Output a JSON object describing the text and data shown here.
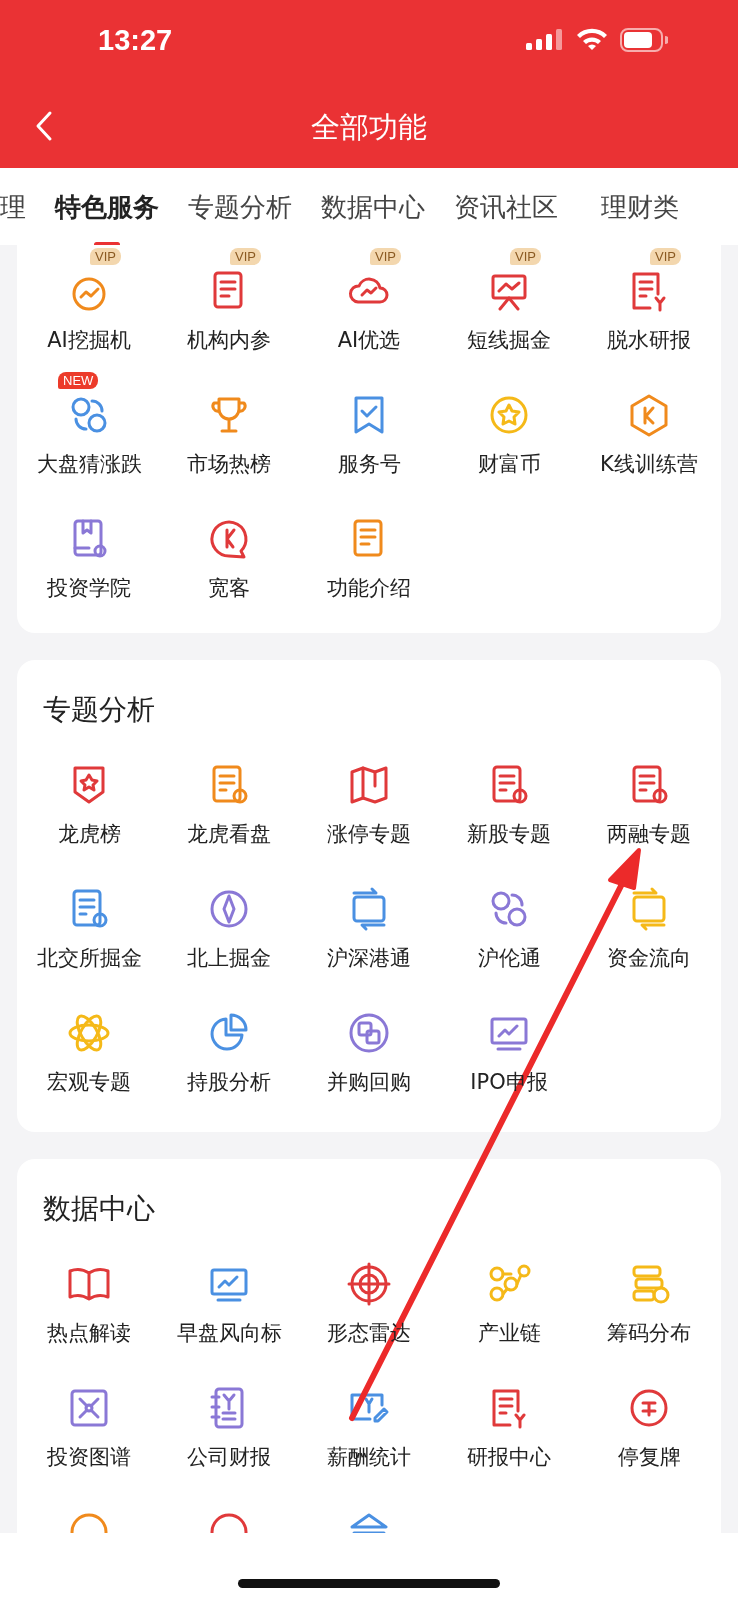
{
  "status_bar": {
    "time": "13:27"
  },
  "header": {
    "title": "全部功能"
  },
  "tabs": [
    {
      "label": "理",
      "selected": false
    },
    {
      "label": "特色服务",
      "selected": true
    },
    {
      "label": "专题分析",
      "selected": false
    },
    {
      "label": "数据中心",
      "selected": false
    },
    {
      "label": "资讯社区",
      "selected": false
    },
    {
      "label": "理财类",
      "selected": false
    }
  ],
  "sections": [
    {
      "items": [
        {
          "label": "AI挖掘机",
          "badge": "VIP",
          "color": "#f08a1c"
        },
        {
          "label": "机构内参",
          "badge": "VIP",
          "color": "#e0393a"
        },
        {
          "label": "AI优选",
          "badge": "VIP",
          "color": "#e0393a"
        },
        {
          "label": "短线掘金",
          "badge": "VIP",
          "color": "#e0393a"
        },
        {
          "label": "脱水研报",
          "badge": "VIP",
          "color": "#e0393a"
        },
        {
          "label": "大盘猜涨跌",
          "badge": "NEW",
          "color": "#4a90e2"
        },
        {
          "label": "市场热榜",
          "color": "#f08a1c"
        },
        {
          "label": "服务号",
          "color": "#4a90e2"
        },
        {
          "label": "财富币",
          "color": "#f5b918"
        },
        {
          "label": "K线训练营",
          "color": "#f08a1c"
        },
        {
          "label": "投资学院",
          "color": "#8a78d6"
        },
        {
          "label": "宽客",
          "color": "#e0393a"
        },
        {
          "label": "功能介绍",
          "color": "#f08a1c"
        }
      ]
    },
    {
      "title": "专题分析",
      "items": [
        {
          "label": "龙虎榜",
          "color": "#e0393a"
        },
        {
          "label": "龙虎看盘",
          "color": "#f08a1c"
        },
        {
          "label": "涨停专题",
          "color": "#e0393a"
        },
        {
          "label": "新股专题",
          "color": "#e0393a"
        },
        {
          "label": "两融专题",
          "color": "#e0393a"
        },
        {
          "label": "北交所掘金",
          "color": "#4a90e2"
        },
        {
          "label": "北上掘金",
          "color": "#8a78d6"
        },
        {
          "label": "沪深港通",
          "color": "#4a90e2"
        },
        {
          "label": "沪伦通",
          "color": "#8a78d6"
        },
        {
          "label": "资金流向",
          "color": "#f5b918"
        },
        {
          "label": "宏观专题",
          "color": "#f5b918"
        },
        {
          "label": "持股分析",
          "color": "#4a90e2"
        },
        {
          "label": "并购回购",
          "color": "#8a78d6"
        },
        {
          "label": "IPO申报",
          "color": "#8a78d6"
        }
      ]
    },
    {
      "title": "数据中心",
      "items": [
        {
          "label": "热点解读",
          "color": "#e0393a"
        },
        {
          "label": "早盘风向标",
          "color": "#4a90e2"
        },
        {
          "label": "形态雷达",
          "color": "#e0393a"
        },
        {
          "label": "产业链",
          "color": "#f5b918"
        },
        {
          "label": "筹码分布",
          "color": "#f5b918"
        },
        {
          "label": "投资图谱",
          "color": "#8a78d6"
        },
        {
          "label": "公司财报",
          "color": "#8a78d6"
        },
        {
          "label": "薪酬统计",
          "color": "#4a90e2"
        },
        {
          "label": "研报中心",
          "color": "#e0393a"
        },
        {
          "label": "停复牌",
          "color": "#e0393a"
        },
        {
          "color": "#f08a1c"
        },
        {
          "color": "#e0393a"
        },
        {
          "color": "#4a90e2"
        }
      ]
    }
  ]
}
